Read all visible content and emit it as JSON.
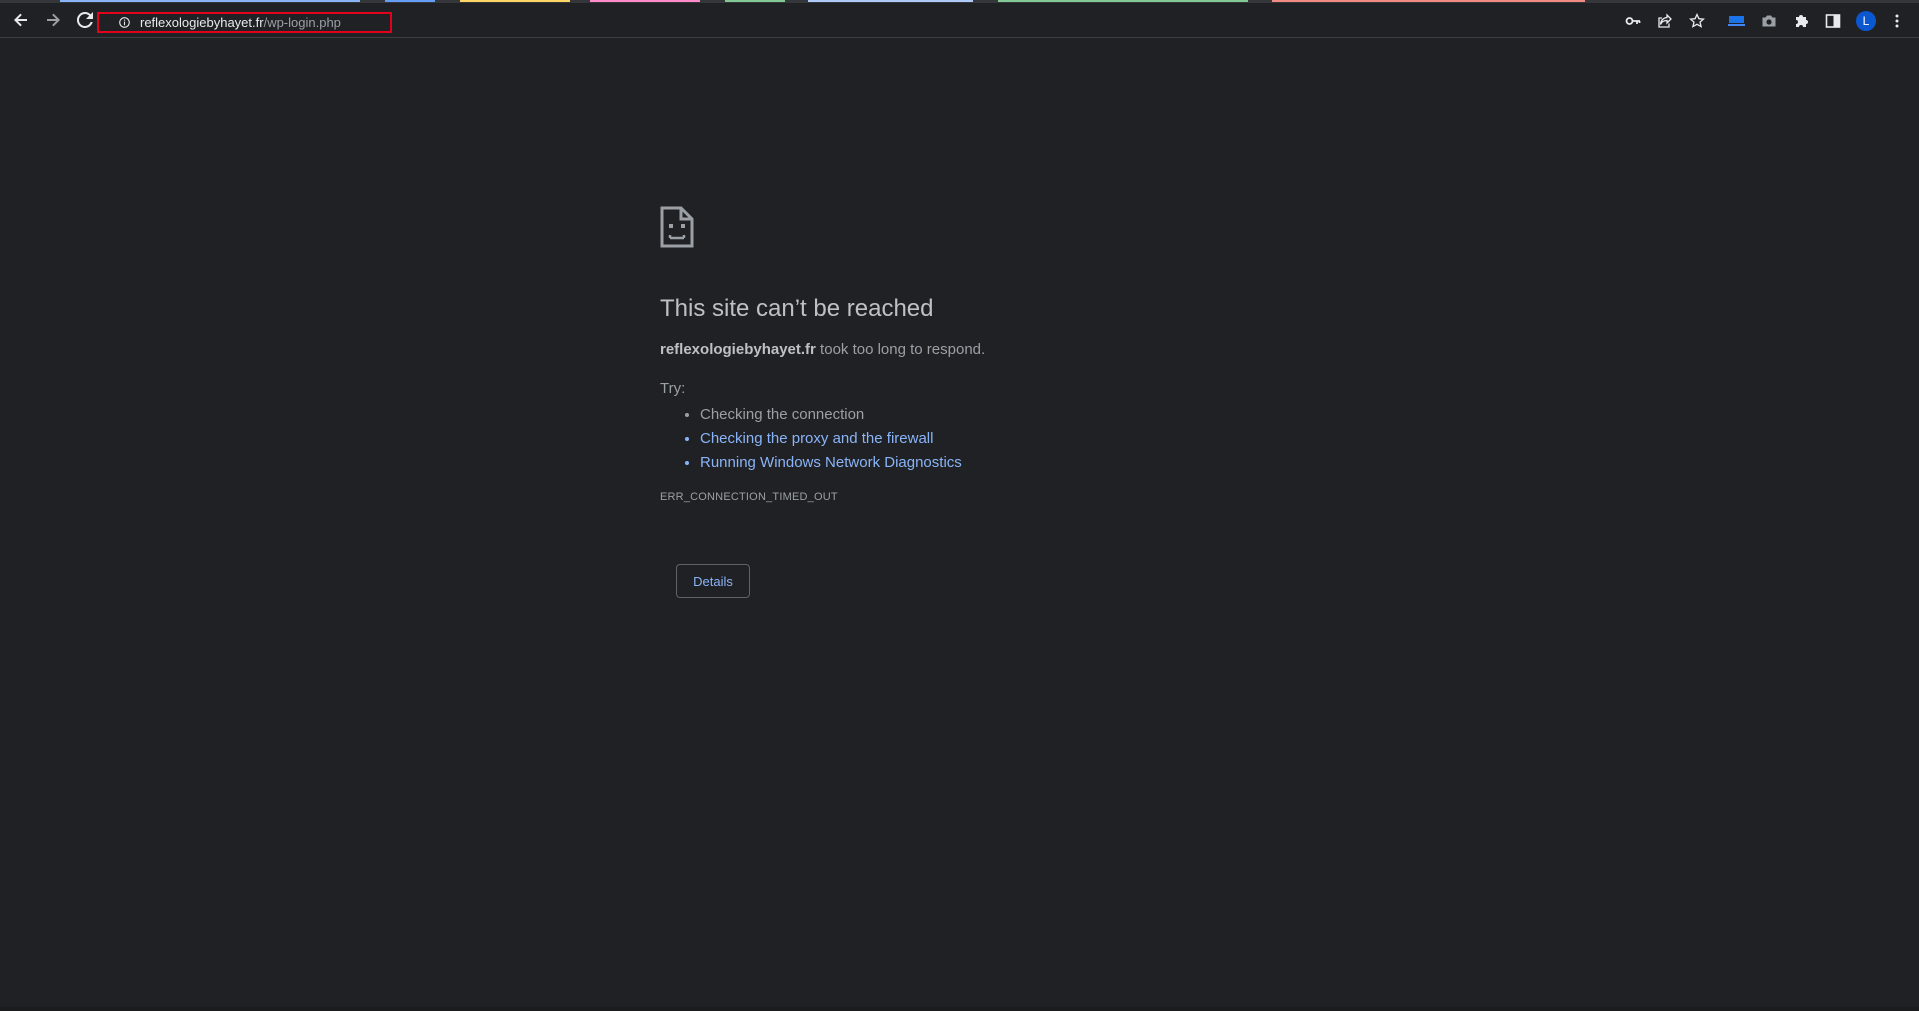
{
  "toolbar": {
    "url_host": "reflexologiebyhayet.fr",
    "url_path": "/wp-login.php",
    "avatar_letter": "L",
    "icons": [
      "back-icon",
      "forward-icon",
      "reload-icon",
      "info-icon",
      "key-icon",
      "share-icon",
      "star-icon",
      "extension-icon",
      "camera-icon",
      "puzzle-icon",
      "side-panel-icon",
      "menu-icon"
    ]
  },
  "error_page": {
    "icon": "sad-document-icon",
    "heading": "This site can’t be reached",
    "host": "reflexologiebyhayet.fr",
    "summary_rest": " took too long to respond.",
    "try_label": "Try:",
    "suggestions": [
      "Checking the connection",
      "Checking the proxy and the firewall",
      "Running Windows Network Diagnostics"
    ],
    "error_code": "ERR_CONNECTION_TIMED_OUT",
    "details_label": "Details"
  },
  "colors": {
    "background": "#202124",
    "link": "#8ab4f8",
    "text": "#9aa0a6",
    "heading": "#bdc1c6",
    "highlight_box": "#e3001b",
    "avatar": "#0b57d0"
  }
}
